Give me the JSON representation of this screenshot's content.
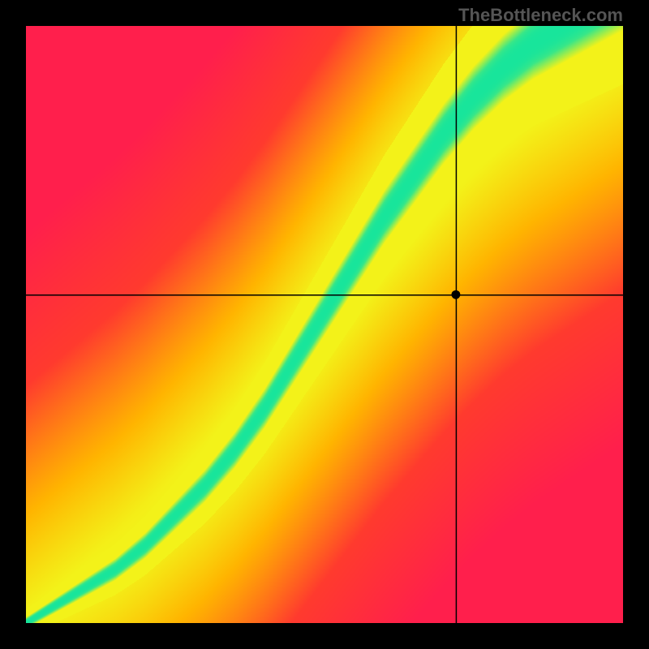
{
  "watermark": "TheBottleneck.com",
  "chart_data": {
    "type": "heatmap",
    "title": "",
    "xlabel": "",
    "ylabel": "",
    "xlim": [
      0,
      1
    ],
    "ylim": [
      0,
      1
    ],
    "grid": false,
    "crosshair": {
      "x": 0.72,
      "y": 0.55
    },
    "marker": {
      "x": 0.72,
      "y": 0.55
    },
    "optimal_curve": {
      "description": "green optimal band center (normalized x,y with origin at bottom-left)",
      "points": [
        [
          0.0,
          0.0
        ],
        [
          0.05,
          0.03
        ],
        [
          0.1,
          0.06
        ],
        [
          0.15,
          0.09
        ],
        [
          0.2,
          0.13
        ],
        [
          0.25,
          0.18
        ],
        [
          0.3,
          0.23
        ],
        [
          0.35,
          0.29
        ],
        [
          0.4,
          0.36
        ],
        [
          0.45,
          0.44
        ],
        [
          0.5,
          0.52
        ],
        [
          0.55,
          0.6
        ],
        [
          0.6,
          0.68
        ],
        [
          0.65,
          0.75
        ],
        [
          0.7,
          0.82
        ],
        [
          0.75,
          0.88
        ],
        [
          0.8,
          0.93
        ],
        [
          0.85,
          0.97
        ],
        [
          0.9,
          1.0
        ]
      ]
    },
    "band_widths": {
      "green_half_width_base": 0.018,
      "yellow_half_width_base": 0.075,
      "width_growth_with_x": 1.8
    },
    "color_stops": {
      "optimal": "#18e59b",
      "near": "#f3f219",
      "mid": "#ffb400",
      "far": "#ff3a2e",
      "worst": "#ff1f4c"
    },
    "resolution": 300
  }
}
